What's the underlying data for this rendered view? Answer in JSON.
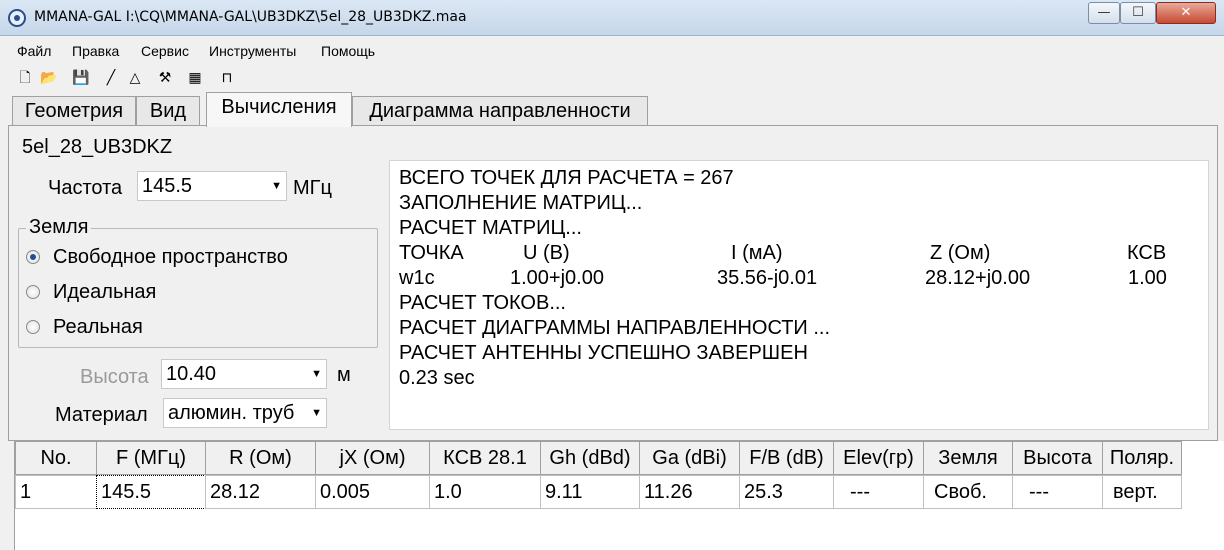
{
  "window": {
    "title": "MMANA-GAL I:\\CQ\\MMANA-GAL\\UB3DKZ\\5el_28_UB3DKZ.maa",
    "min_label": "—",
    "max_label": "☐",
    "close_label": "✕"
  },
  "menu": [
    "Файл",
    "Правка",
    "Сервис",
    "Инструменты",
    "Помощь"
  ],
  "toolbar": [
    {
      "icon": "new-file-icon",
      "glyph": "🗋"
    },
    {
      "icon": "open-folder-icon",
      "glyph": "📂"
    },
    {
      "icon": "save-icon",
      "glyph": "💾"
    },
    {
      "icon": "line-icon",
      "glyph": "╱"
    },
    {
      "icon": "triangle-icon",
      "glyph": "△"
    },
    {
      "icon": "tools-icon",
      "glyph": "⚒"
    },
    {
      "icon": "calculator-icon",
      "glyph": "▦"
    },
    {
      "icon": "antenna-icon",
      "glyph": "⊓"
    }
  ],
  "tabs": [
    "Геометрия",
    "Вид",
    "Вычисления",
    "Диаграмма направленности"
  ],
  "active_tab": "Вычисления",
  "antenna_name": "5el_28_UB3DKZ",
  "frequency": {
    "label": "Частота",
    "value": "145.5",
    "unit": "МГц"
  },
  "ground": {
    "legend": "Земля",
    "options": [
      "Свободное пространство",
      "Идеальная",
      "Реальная"
    ],
    "selected": "Свободное пространство"
  },
  "height": {
    "label": "Высота",
    "value": "10.40",
    "unit": "м"
  },
  "material": {
    "label": "Материал",
    "value": "алюмин. труб"
  },
  "output": {
    "lines": [
      "ВСЕГО ТОЧЕК ДЛЯ РАСЧЕТА = 267",
      "ЗАПОЛНЕНИЕ МАТРИЦ...",
      "РАСЧЕТ МАТРИЦ..."
    ],
    "table_header": [
      "ТОЧКА",
      "U (В)",
      "I (мА)",
      "Z (Ом)",
      "КСВ"
    ],
    "table_row": [
      "w1c",
      "1.00+j0.00",
      "35.56-j0.01",
      "28.12+j0.00",
      "1.00"
    ],
    "lines_after": [
      "РАСЧЕТ ТОКОВ...",
      "РАСЧЕТ ДИАГРАММЫ НАПРАВЛЕННОСТИ ...",
      "РАСЧЕТ АНТЕННЫ УСПЕШНО ЗАВЕРШЕН",
      "0.23 sec"
    ]
  },
  "results_table": {
    "columns": [
      "No.",
      "F (МГц)",
      "R (Ом)",
      "jX (Ом)",
      "КСВ 28.1",
      "Gh (dBd)",
      "Ga (dBi)",
      "F/B (dB)",
      "Elev(гр)",
      "Земля",
      "Высота",
      "Поляр."
    ],
    "rows": [
      [
        "1",
        "145.5",
        "28.12",
        "0.005",
        "1.0",
        "9.11",
        "11.26",
        "25.3",
        "---",
        "Своб.",
        "---",
        "верт."
      ]
    ]
  }
}
